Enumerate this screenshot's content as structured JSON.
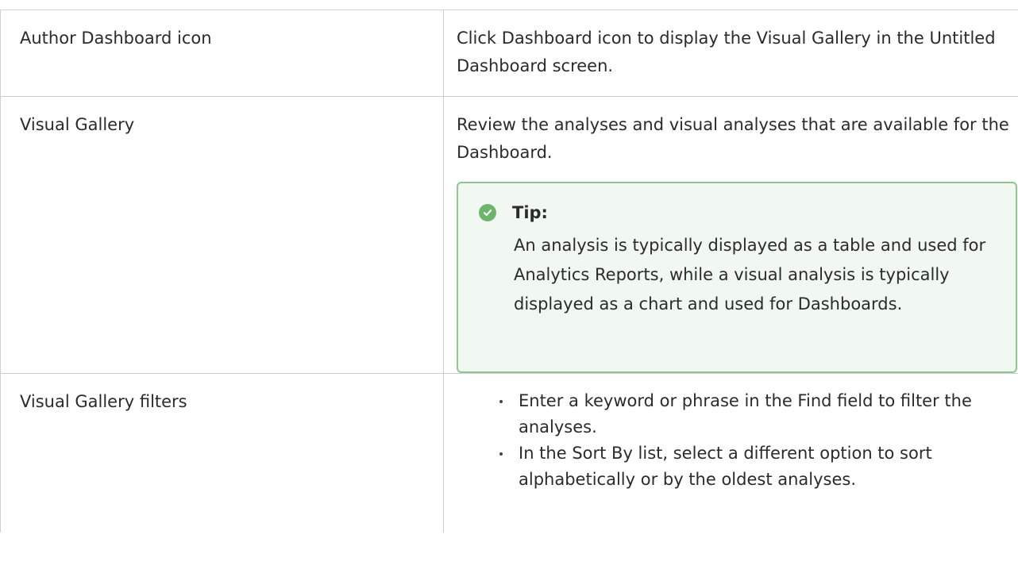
{
  "rows": [
    {
      "term": "Author Dashboard icon",
      "description": "Click Dashboard icon to display the Visual Gallery in the Untitled Dashboard screen."
    },
    {
      "term": "Visual Gallery",
      "description": "Review the analyses and visual analyses that are available for the Dashboard.",
      "tip": {
        "title": "Tip:",
        "icon": "check-circle-icon",
        "text": "An analysis is typically displayed as a table and used for Analytics Reports, while a visual analysis is typically displayed as a chart and used for Dashboards."
      }
    },
    {
      "term": "Visual Gallery filters",
      "bullets": [
        "Enter a keyword or phrase in the Find field to filter the analyses.",
        "In the Sort By list, select a different option to sort alphabetically or by the oldest analyses."
      ]
    }
  ],
  "colors": {
    "tip_background": "#f1f8f1",
    "tip_border": "#8fc590",
    "tip_icon": "#6cb66c",
    "table_border": "#cfcfcf"
  }
}
